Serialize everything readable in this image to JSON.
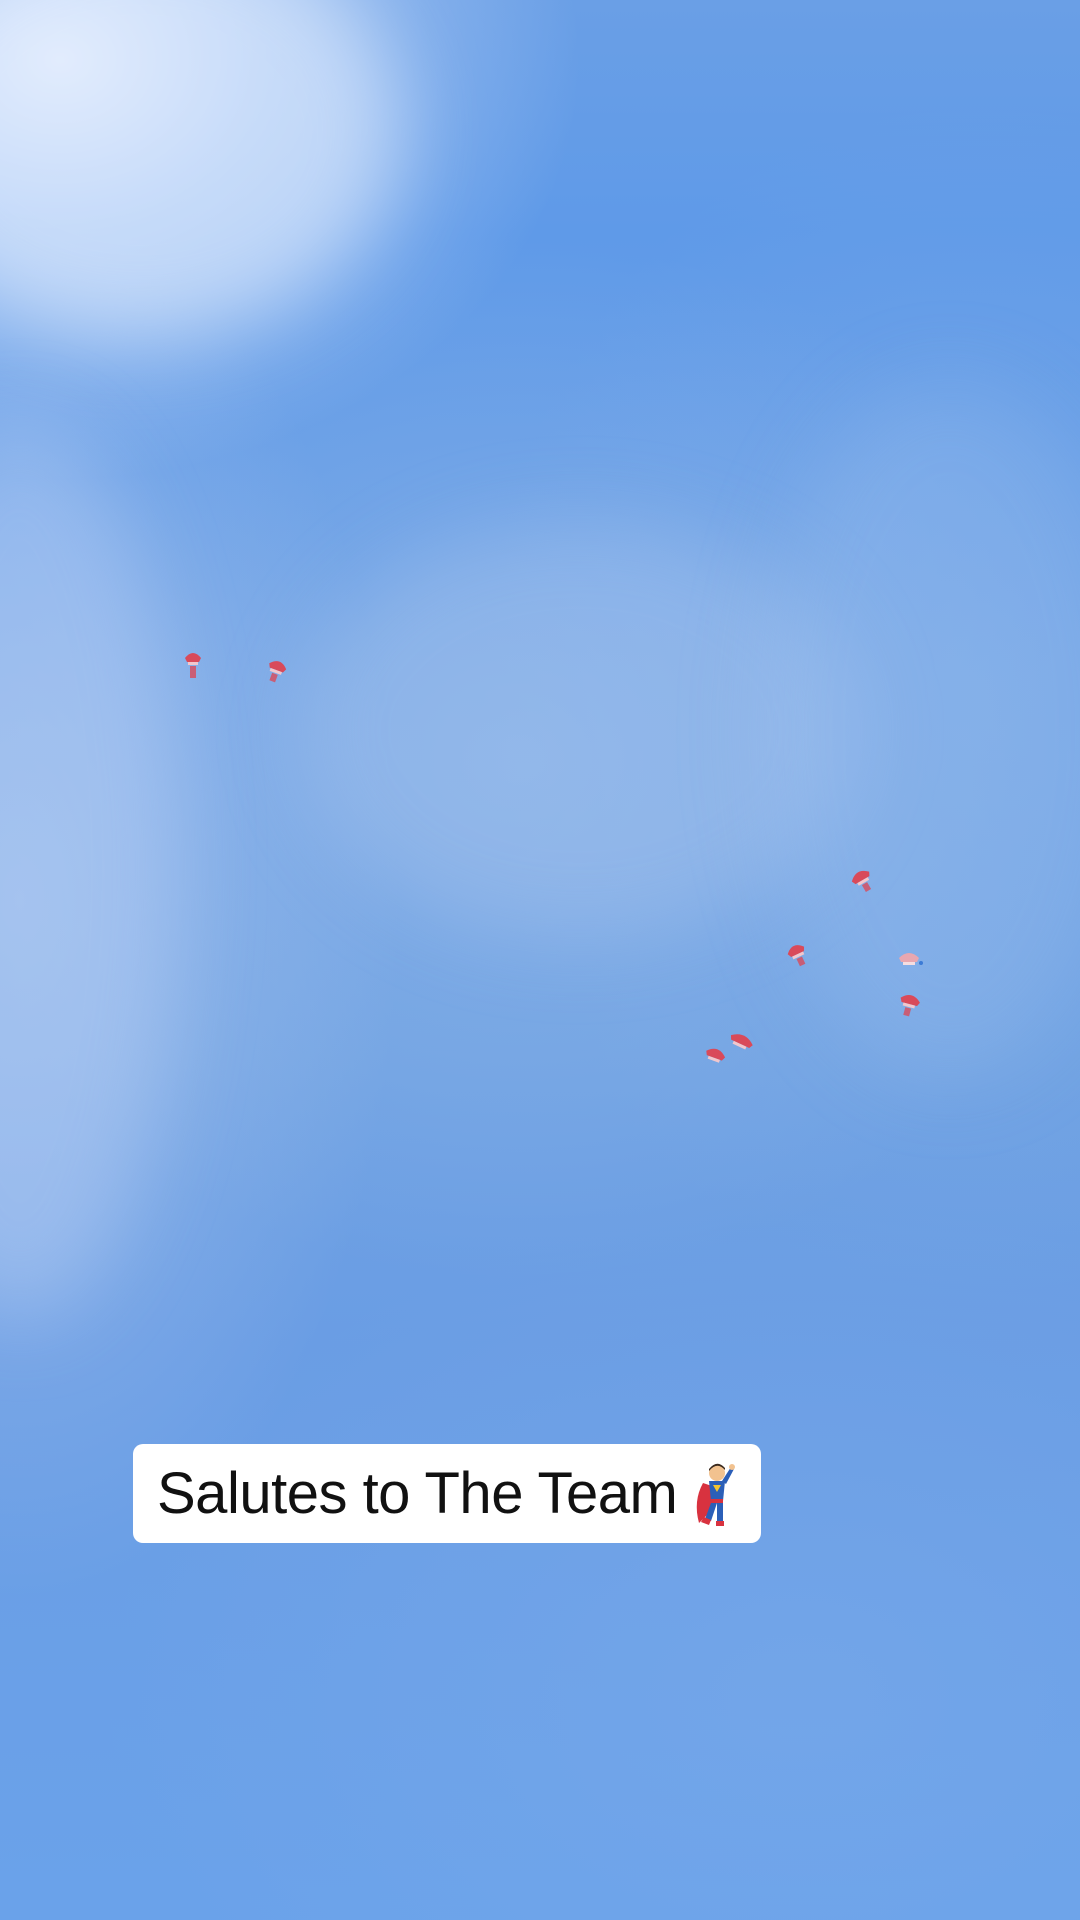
{
  "caption": {
    "text": "Salutes to The Team",
    "icon": "superhero-icon"
  },
  "scene": {
    "subject": "parachutists",
    "sky_color": "#6a9fe6",
    "canopy_color": "#d94a5a"
  }
}
